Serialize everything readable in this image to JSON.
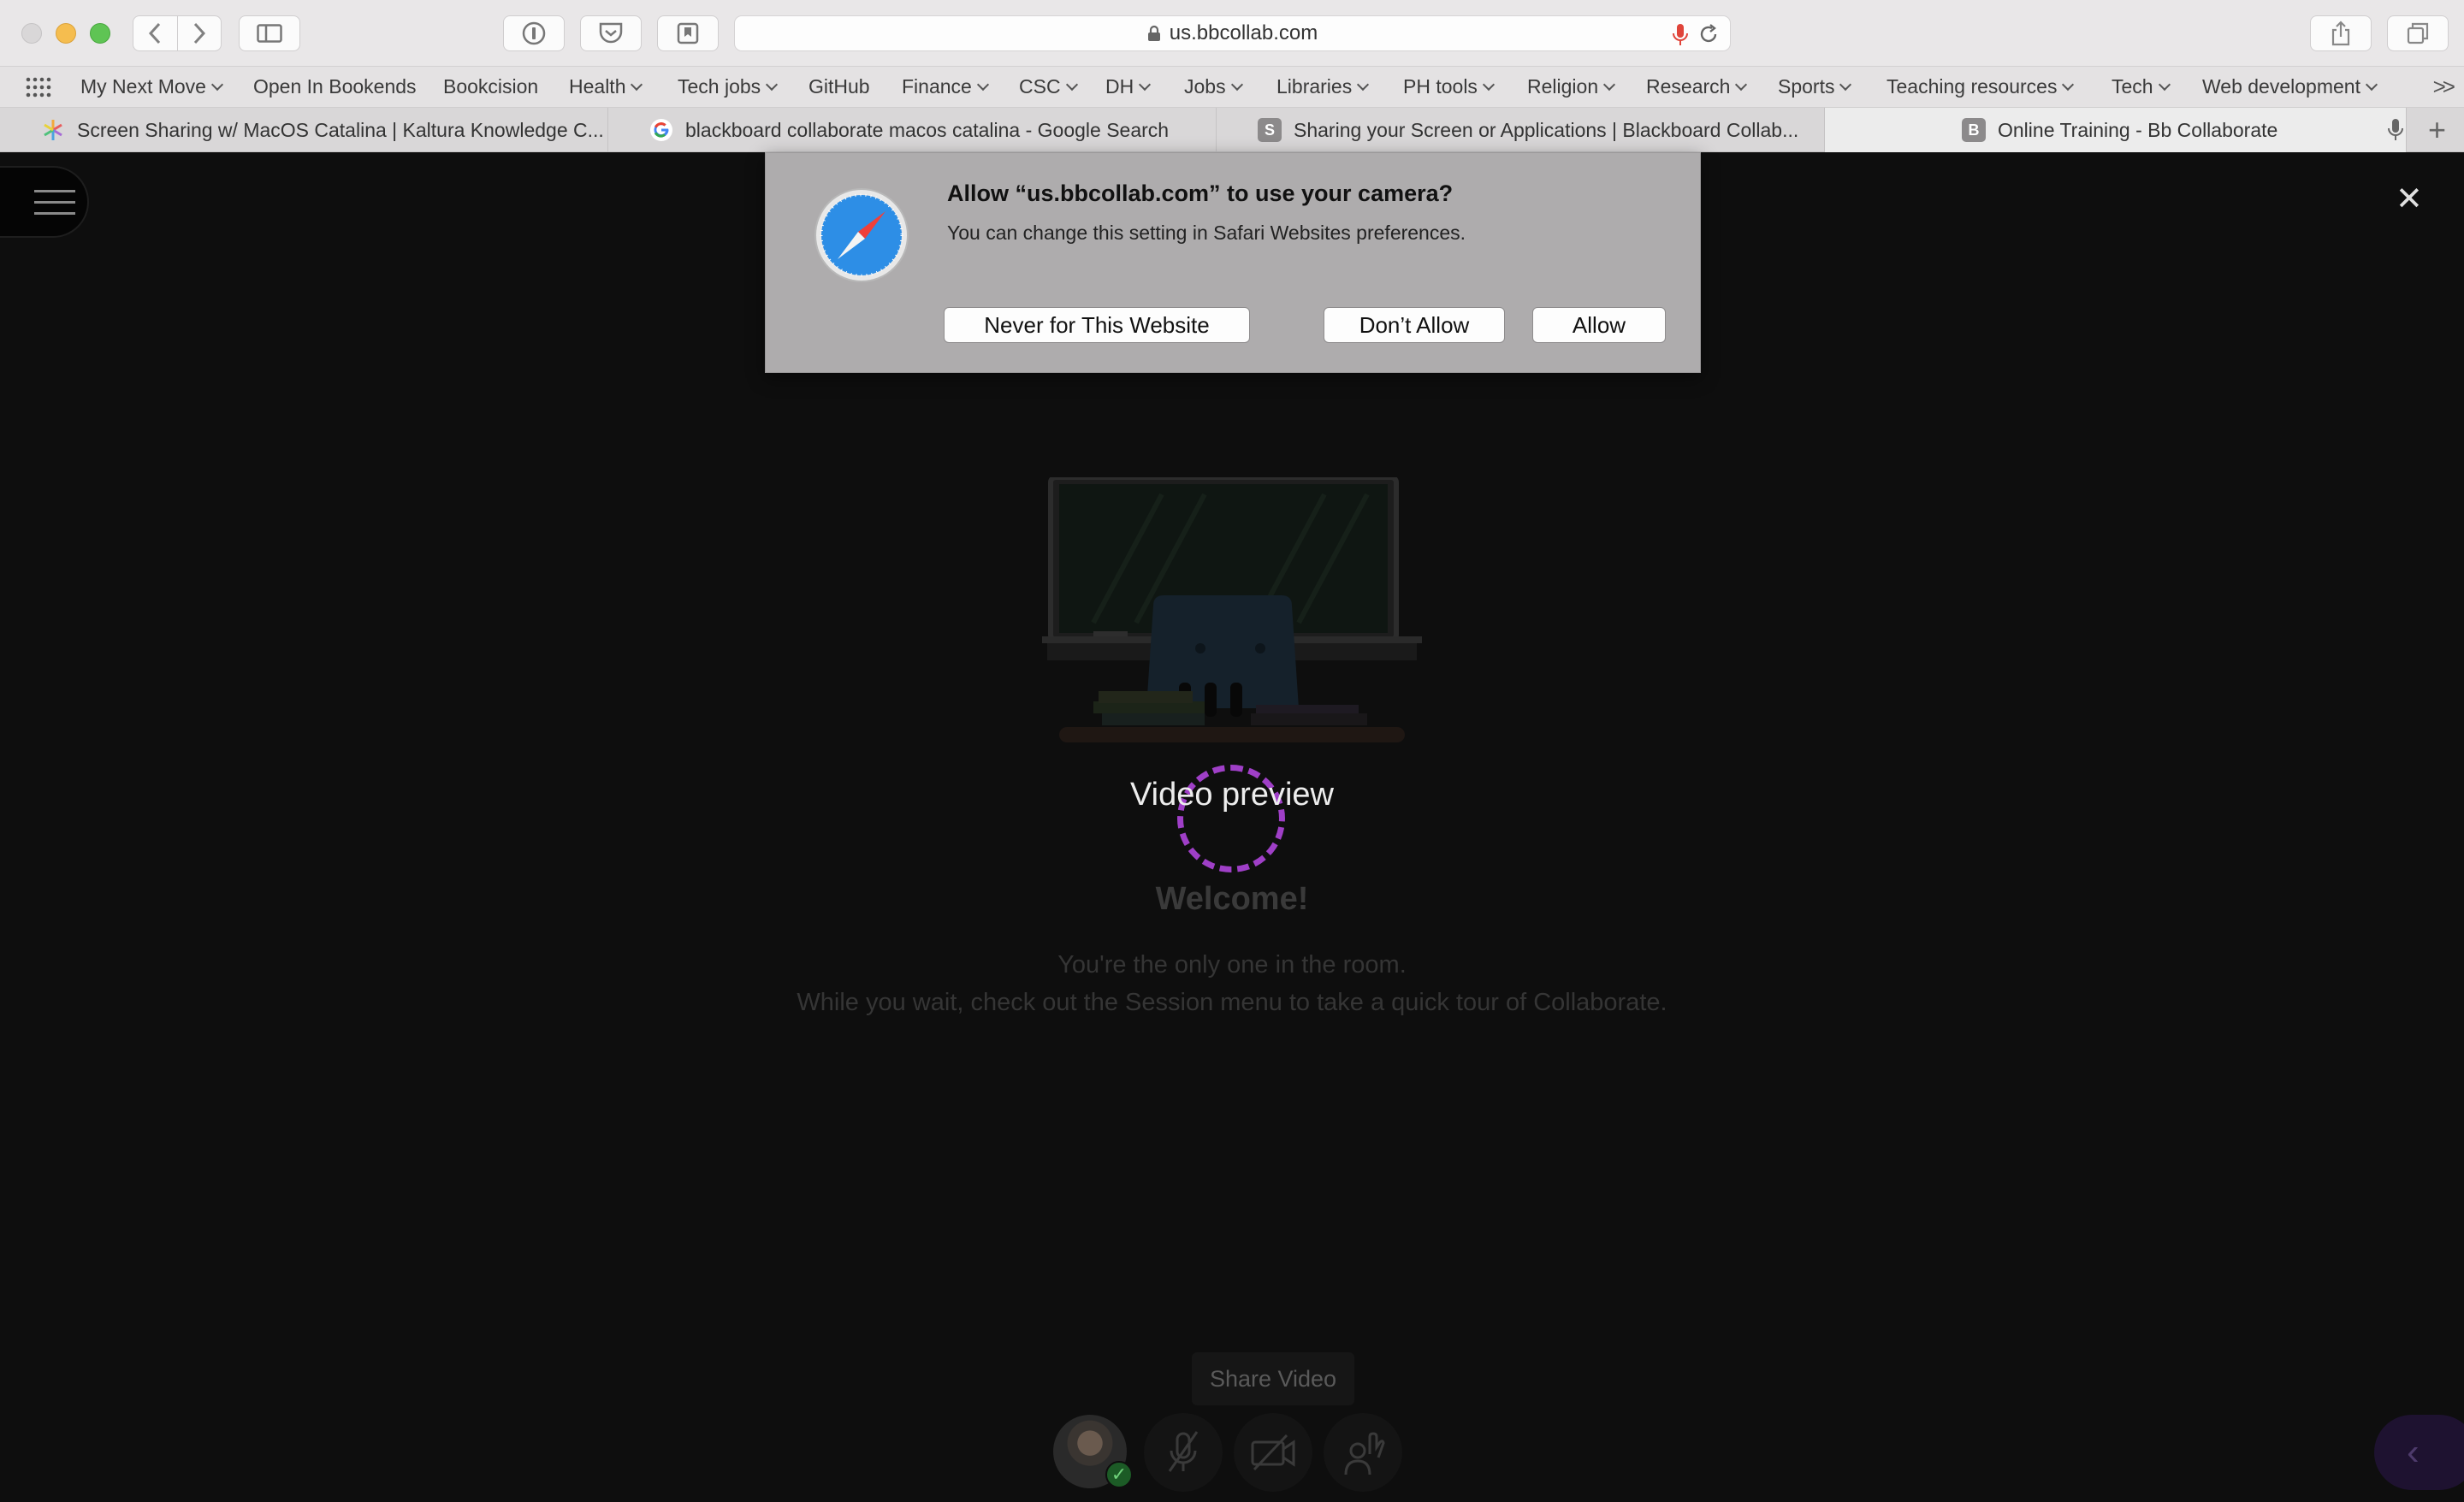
{
  "browser": {
    "url": "us.bbcollab.com",
    "bookmarks": [
      {
        "label": "My Next Move",
        "dropdown": true
      },
      {
        "label": "Open In Bookends",
        "dropdown": false
      },
      {
        "label": "Bookcision",
        "dropdown": false
      },
      {
        "label": "Health",
        "dropdown": true
      },
      {
        "label": "Tech jobs",
        "dropdown": true
      },
      {
        "label": "GitHub",
        "dropdown": false
      },
      {
        "label": "Finance",
        "dropdown": true
      },
      {
        "label": "CSC",
        "dropdown": true
      },
      {
        "label": "DH",
        "dropdown": true
      },
      {
        "label": "Jobs",
        "dropdown": true
      },
      {
        "label": "Libraries",
        "dropdown": true
      },
      {
        "label": "PH tools",
        "dropdown": true
      },
      {
        "label": "Religion",
        "dropdown": true
      },
      {
        "label": "Research",
        "dropdown": true
      },
      {
        "label": "Sports",
        "dropdown": true
      },
      {
        "label": "Teaching resources",
        "dropdown": true
      },
      {
        "label": "Tech",
        "dropdown": true
      },
      {
        "label": "Web development",
        "dropdown": true
      }
    ],
    "bookmarks_more": ">>",
    "tabs": [
      {
        "title": "Screen Sharing w/ MacOS Catalina | Kaltura Knowledge C...",
        "favicon": "kaltura-pinwheel-icon",
        "active": false
      },
      {
        "title": "blackboard collaborate macos catalina - Google Search",
        "favicon": "google-g-icon",
        "active": false
      },
      {
        "title": "Sharing your Screen or Applications | Blackboard Collab...",
        "favicon_letter": "S",
        "active": false
      },
      {
        "title": "Online Training - Bb Collaborate",
        "favicon_letter": "B",
        "active": true
      }
    ]
  },
  "dialog": {
    "title": "Allow “us.bbcollab.com” to use your camera?",
    "subtitle": "You can change this setting in Safari Websites preferences.",
    "never_label": "Never for This Website",
    "dont_allow_label": "Don’t Allow",
    "allow_label": "Allow",
    "icon": "safari-compass-icon"
  },
  "collaborate": {
    "video_preview": "Video preview",
    "welcome": "Welcome!",
    "only_one": "You're the only one in the room.",
    "wait_message": "While you wait, check out the Session menu to take a quick tour of Collaborate.",
    "share_video_tooltip": "Share Video",
    "spinner_color": "#9f3fc7"
  }
}
